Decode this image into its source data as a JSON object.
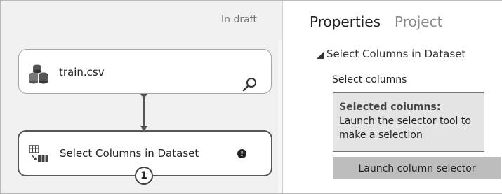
{
  "canvas": {
    "status": "In draft",
    "modules": [
      {
        "label": "train.csv",
        "icon": "dataset-icon",
        "action_icon": "search-icon"
      },
      {
        "label": "Select Columns in Dataset",
        "icon": "select-columns-icon",
        "warning": "!",
        "badge": "1"
      }
    ]
  },
  "properties": {
    "tabs": [
      {
        "label": "Properties",
        "active": true
      },
      {
        "label": "Project",
        "active": false
      }
    ],
    "section": {
      "title": "Select Columns in Dataset",
      "collapse_icon": "triangle-down-icon",
      "field_label": "Select columns",
      "selected_heading": "Selected columns:",
      "selected_text": "Launch the selector tool to make a selection",
      "launch_button": "Launch column selector"
    }
  },
  "colors": {
    "canvas_bg": "#f0f0f0",
    "button_bg": "#bdbdbd",
    "info_bg": "#e4e4e4"
  }
}
